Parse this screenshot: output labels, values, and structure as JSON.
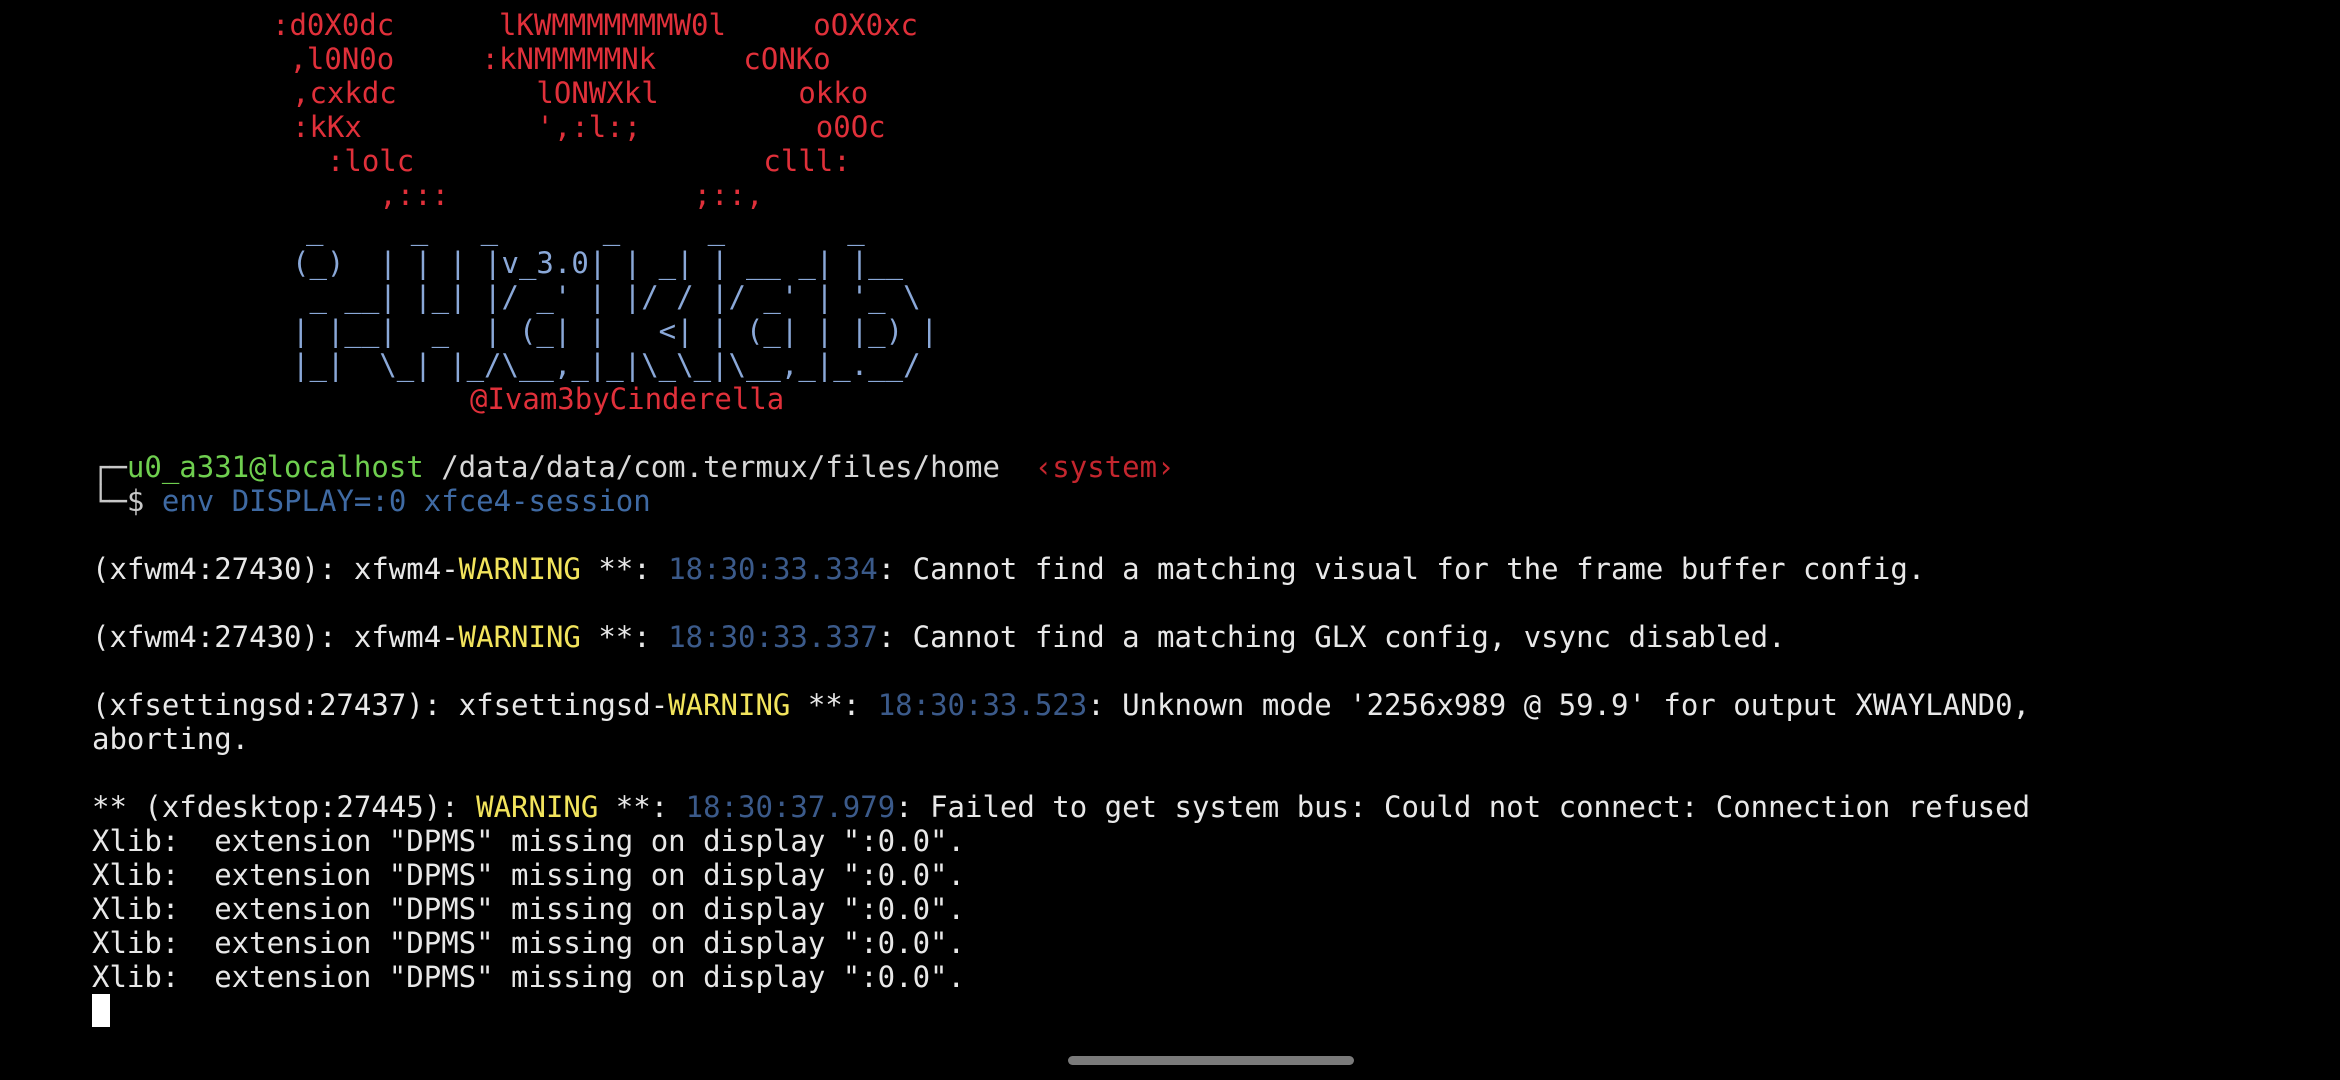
{
  "banner": {
    "art_red": [
      ":d0X0dc      lKWMMMMMMMW0l     oOX0xc",
      " ,l0N0o     :kNMMMMMNk     cONKo",
      ",cxkdc        lONWXkl        okko",
      ":kKx          ',:l:;          o0Oc",
      "  :lolc                    clll:",
      "     ,:::              ;::,"
    ],
    "art_blue": [
      "_     _   _      _     _       _",
      "(_)  | | | |v_3.0| | _| | __ _| |__",
      " _ __| |_| |/ _' | |/ / |/ _' | '_ \\",
      "| |__|  _  | (_| |   <| | (_| | |_) |",
      "|_|  \\_| |_/\\__,_|_|\\_\\_|\\__,_|_.__/"
    ],
    "author": "@Ivam3byCinderella"
  },
  "prompt": {
    "tree_top": "┌─",
    "user_host": "u0_a331@localhost",
    "cwd": "/data/data/com.termux/files/home",
    "context": "‹system›",
    "tree_bottom": "└─",
    "symbol": "$",
    "command": "env DISPLAY=:0 xfce4-session"
  },
  "output": {
    "warn1": {
      "prefix": "(xfwm4:27430): xfwm4-",
      "level": "WARNING",
      "sep": " **: ",
      "time": "18:30:33.334",
      "msg": ": Cannot find a matching visual for the frame buffer config."
    },
    "warn2": {
      "prefix": "(xfwm4:27430): xfwm4-",
      "level": "WARNING",
      "sep": " **: ",
      "time": "18:30:33.337",
      "msg": ": Cannot find a matching GLX config, vsync disabled."
    },
    "warn3": {
      "prefix": "(xfsettingsd:27437): xfsettingsd-",
      "level": "WARNING",
      "sep": " **: ",
      "time": "18:30:33.523",
      "msg": ": Unknown mode '2256x989 @ 59.9' for output XWAYLAND0,",
      "cont": "aborting."
    },
    "warn4": {
      "prefix": "** (xfdesktop:27445): ",
      "level": "WARNING",
      "sep": " **: ",
      "time": "18:30:37.979",
      "msg": ": Failed to get system bus: Could not connect: Connection refused"
    },
    "xlib_lines": [
      "Xlib:  extension \"DPMS\" missing on display \":0.0\".",
      "Xlib:  extension \"DPMS\" missing on display \":0.0\".",
      "Xlib:  extension \"DPMS\" missing on display \":0.0\".",
      "Xlib:  extension \"DPMS\" missing on display \":0.0\".",
      "Xlib:  extension \"DPMS\" missing on display \":0.0\"."
    ]
  },
  "colors": {
    "background": "#000000",
    "banner_red": "#e0303a",
    "banner_blue": "#8aa8d8",
    "user_green": "#6fcf4f",
    "warning_yellow": "#f2e45c",
    "timestamp_blue": "#3b5a8a",
    "command_blue": "#3f6aa3"
  }
}
